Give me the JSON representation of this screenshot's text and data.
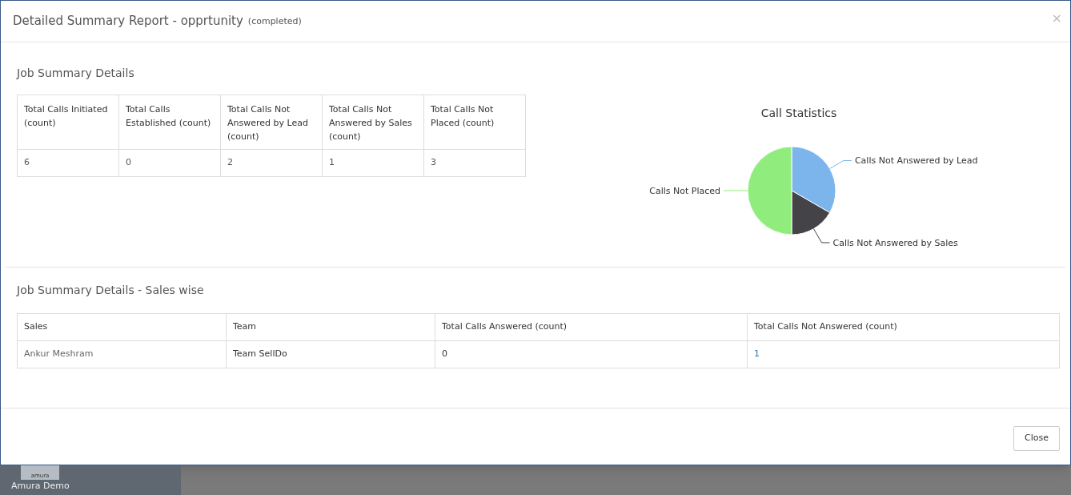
{
  "modal": {
    "title": "Detailed Summary Report - opprtunity",
    "status": "(completed)",
    "close_glyph": "×"
  },
  "job_summary": {
    "heading": "Job Summary Details",
    "columns": [
      "Total Calls Initiated (count)",
      "Total Calls Established (count)",
      "Total Calls Not Answered by Lead (count)",
      "Total Calls Not Answered by Sales (count)",
      "Total Calls Not Placed (count)"
    ],
    "row": [
      "6",
      "0",
      "2",
      "1",
      "3"
    ]
  },
  "call_statistics": {
    "chart_data": {
      "type": "pie",
      "title": "Call Statistics",
      "categories": [
        "Calls Not Answered by Lead",
        "Calls Not Answered by Sales",
        "Calls Not Placed"
      ],
      "values": [
        33.33,
        16.67,
        50
      ],
      "colors": [
        "#7cb5ec",
        "#434348",
        "#90ed7d"
      ]
    }
  },
  "sales_wise": {
    "heading": "Job Summary Details - Sales wise",
    "columns": [
      "Sales",
      "Team",
      "Total Calls Answered (count)",
      "Total Calls Not Answered (count)"
    ],
    "rows": [
      [
        "Ankur Meshram",
        "Team SellDo",
        "0",
        "1"
      ]
    ]
  },
  "footer": {
    "close_button": "Close"
  },
  "background": {
    "logo_text": "amura",
    "app_label": "Amura Demo"
  }
}
